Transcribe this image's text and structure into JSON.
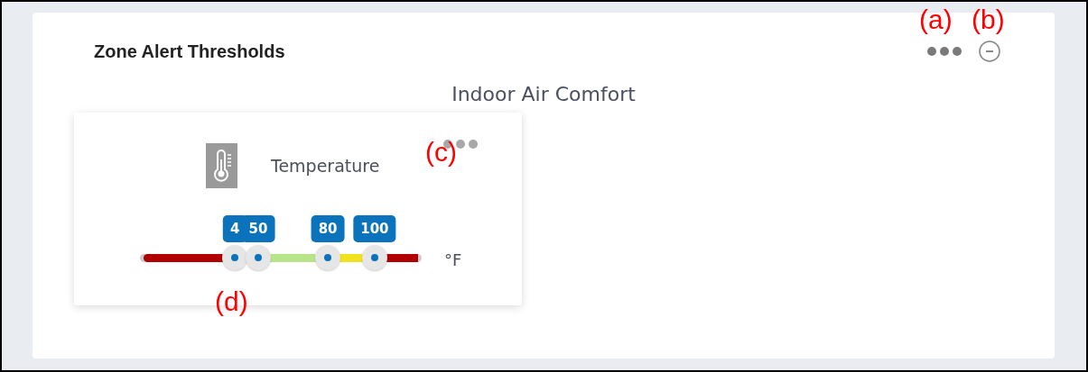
{
  "panel": {
    "title": "Zone Alert Thresholds",
    "subtitle": "Indoor Air Comfort"
  },
  "widgets": [
    {
      "name": "Temperature",
      "unit": "°F",
      "zones": [
        {
          "color": "#b00000"
        },
        {
          "color": "#b9e58a"
        },
        {
          "color": "#f2e21d"
        },
        {
          "color": "#b00000"
        }
      ],
      "thresholds": [
        {
          "label": "4",
          "level": 0.337
        },
        {
          "label": "50",
          "level": 0.42
        },
        {
          "label": "80",
          "level": 0.667
        },
        {
          "label": "100",
          "level": 0.833
        }
      ]
    }
  ],
  "callouts": [
    {
      "label": "(a)"
    },
    {
      "label": "(b)"
    },
    {
      "label": "(c)"
    },
    {
      "label": "(d)"
    }
  ]
}
